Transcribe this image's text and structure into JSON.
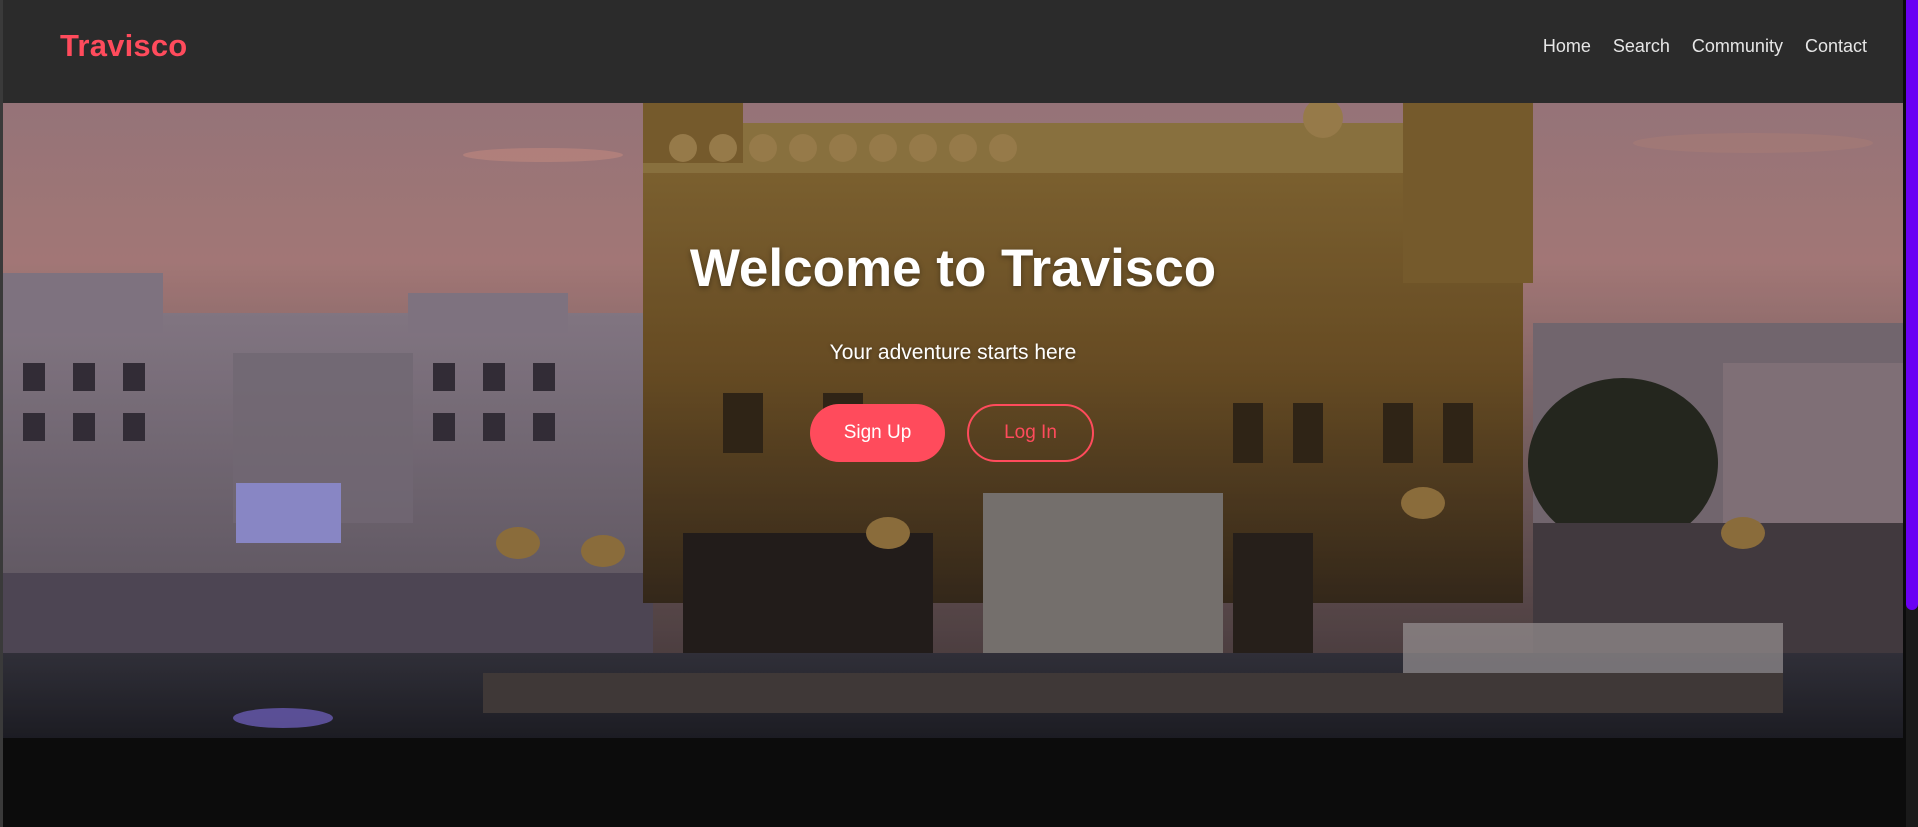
{
  "navbar": {
    "brand": "Travisco",
    "links": [
      "Home",
      "Search",
      "Community",
      "Contact"
    ]
  },
  "hero": {
    "title": "Welcome to Travisco",
    "subtitle": "Your adventure starts here",
    "signup_label": "Sign Up",
    "login_label": "Log In",
    "background_image": "golden-temple-photo"
  },
  "colors": {
    "accent": "#ff4b5c",
    "navbar_bg": "#2b2b2b",
    "page_bg": "#0c0c0c",
    "scrollbar_thumb": "#6a00f4"
  }
}
